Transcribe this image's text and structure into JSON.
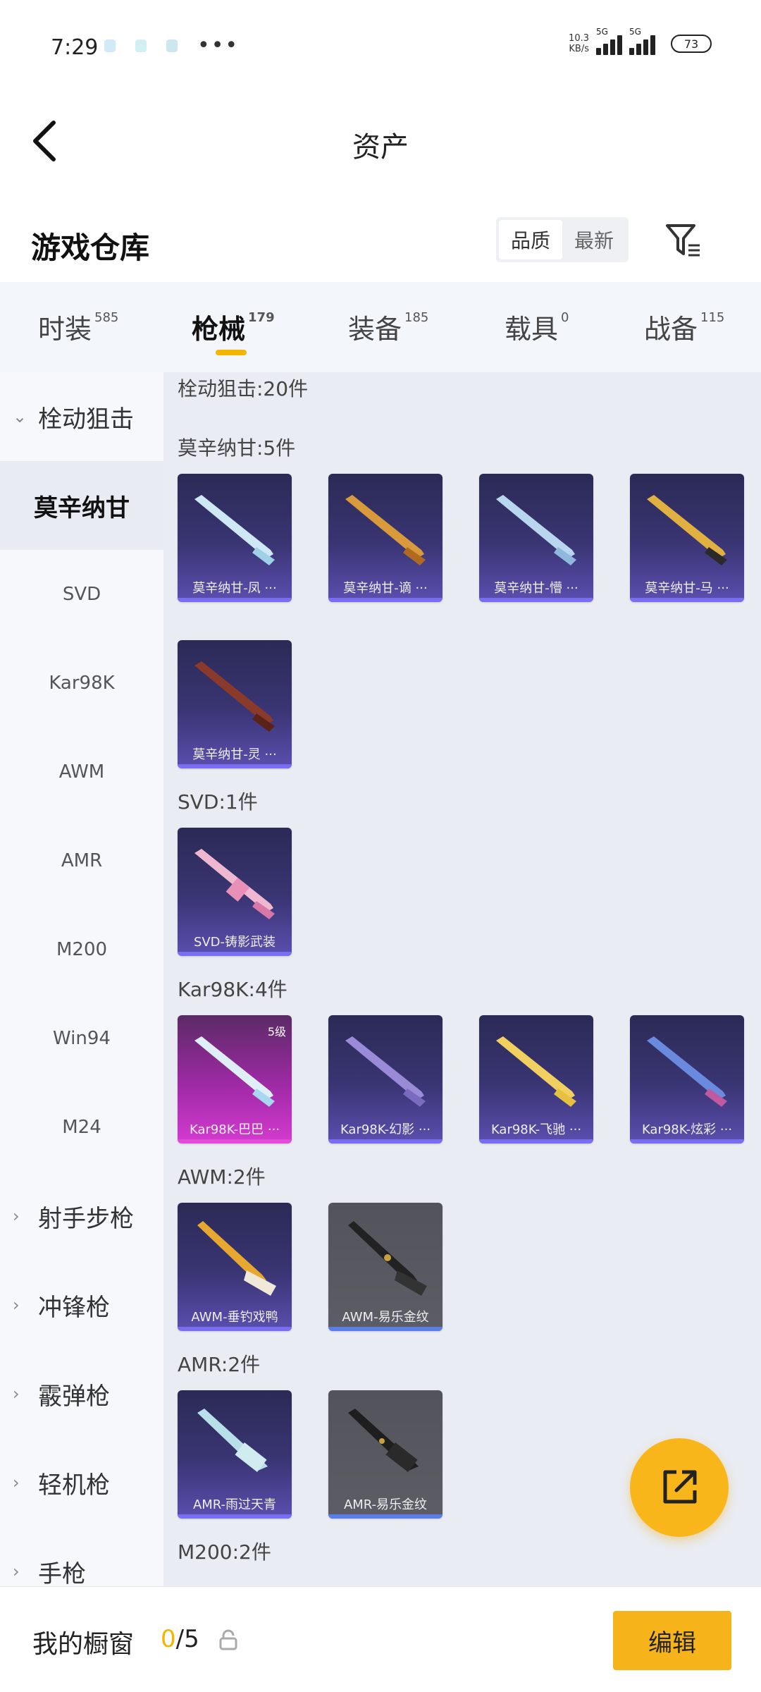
{
  "status_bar": {
    "time": "7:29",
    "net_speed_value": "10.3",
    "net_speed_unit": "KB/s",
    "sim1_tag": "5G",
    "sim2_tag": "5G",
    "battery": "73"
  },
  "header": {
    "title": "资产"
  },
  "warehouse": {
    "title": "游戏仓库",
    "sort_quality": "品质",
    "sort_newest": "最新"
  },
  "tabs": [
    {
      "label": "时装",
      "count": "585"
    },
    {
      "label": "枪械",
      "count": "179"
    },
    {
      "label": "装备",
      "count": "185"
    },
    {
      "label": "载具",
      "count": "0"
    },
    {
      "label": "战备",
      "count": "115"
    }
  ],
  "sidebar": {
    "groups": [
      {
        "label": "栓动狙击"
      },
      {
        "label": "射手步枪"
      },
      {
        "label": "冲锋枪"
      },
      {
        "label": "霰弹枪"
      },
      {
        "label": "轻机枪"
      },
      {
        "label": "手枪"
      }
    ],
    "subs": [
      {
        "label": "莫辛纳甘"
      },
      {
        "label": "SVD"
      },
      {
        "label": "Kar98K"
      },
      {
        "label": "AWM"
      },
      {
        "label": "AMR"
      },
      {
        "label": "M200"
      },
      {
        "label": "Win94"
      },
      {
        "label": "M24"
      }
    ]
  },
  "content": {
    "category_total": "栓动狙击:20件",
    "sections": [
      {
        "label": "莫辛纳甘:5件",
        "items": [
          "莫辛纳甘-凤 ···",
          "莫辛纳甘-谪 ···",
          "莫辛纳甘-懵 ···",
          "莫辛纳甘-马 ···",
          "莫辛纳甘-灵 ···"
        ]
      },
      {
        "label": "SVD:1件",
        "items": [
          "SVD-铸影武装"
        ]
      },
      {
        "label": "Kar98K:4件",
        "items": [
          "Kar98K-巴巴 ···",
          "Kar98K-幻影 ···",
          "Kar98K-飞驰 ···",
          "Kar98K-炫彩 ···"
        ],
        "first_level": "5级"
      },
      {
        "label": "AWM:2件",
        "items": [
          "AWM-垂钓戏鸭",
          "AWM-易乐金纹"
        ]
      },
      {
        "label": "AMR:2件",
        "items": [
          "AMR-雨过天青",
          "AMR-易乐金纹"
        ]
      },
      {
        "label": "M200:2件",
        "items": []
      }
    ]
  },
  "bottom_bar": {
    "window_label": "我的橱窗",
    "window_current": "0",
    "window_total": "/5",
    "edit_label": "编辑"
  },
  "colors": {
    "accent": "#f7b41a",
    "card_purple": "#3a3574",
    "card_pink": "#a02aa6",
    "card_gray": "#5c5d66"
  },
  "icons": [
    "back-arrow-icon",
    "filter-icon",
    "share-export-icon",
    "lock-icon"
  ]
}
